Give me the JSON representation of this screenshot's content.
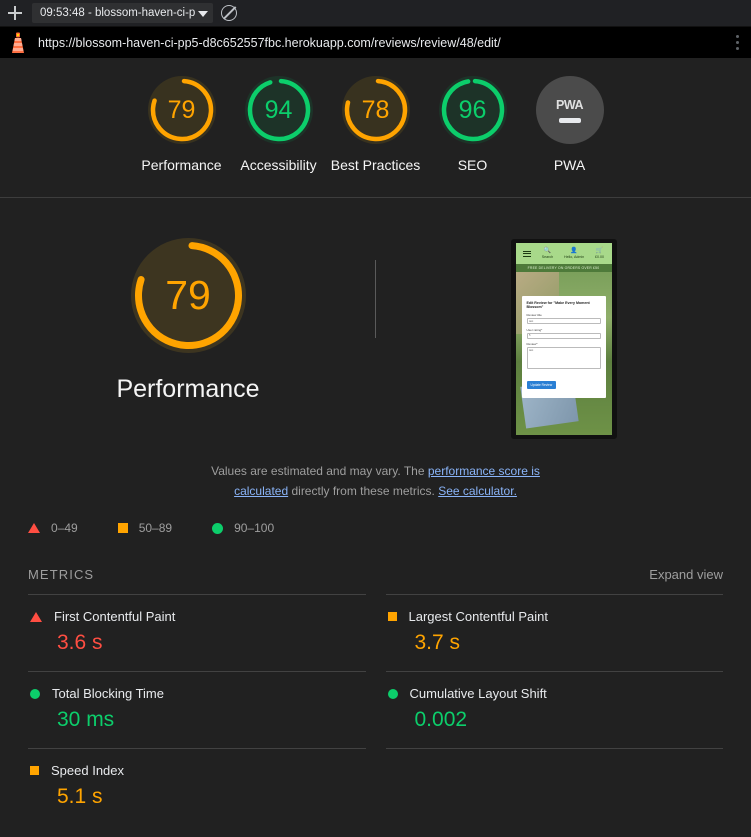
{
  "browser": {
    "new_tab_label": "+",
    "tab_selector_label": "09:53:48 - blossom-haven-ci-p",
    "block_icon": "no-entry-icon",
    "lighthouse_icon": "lighthouse-icon",
    "url": "https://blossom-haven-ci-pp5-d8c652557fbc.herokuapp.com/reviews/review/48/edit/",
    "menu_icon": "kebab-menu-icon"
  },
  "colors": {
    "orange": "#ffa400",
    "green": "#0cce6b",
    "red": "#ff4e42",
    "gray": "#757575",
    "link": "#8ab4f8",
    "background": "#212121"
  },
  "gauges": [
    {
      "score": "79",
      "label": "Performance",
      "status": "average"
    },
    {
      "score": "94",
      "label": "Accessibility",
      "status": "pass"
    },
    {
      "score": "78",
      "label": "Best Practices",
      "status": "average"
    },
    {
      "score": "96",
      "label": "SEO",
      "status": "pass"
    },
    {
      "score": "",
      "label": "PWA",
      "status": "null"
    }
  ],
  "category": {
    "score": "79",
    "title": "Performance",
    "description_part1": "Values are estimated and may vary. The ",
    "link1": "performance score is calculated",
    "description_part2": " directly from these metrics. ",
    "link2": "See calculator."
  },
  "legend": [
    {
      "marker": "triangle",
      "range": "0–49"
    },
    {
      "marker": "square",
      "range": "50–89"
    },
    {
      "marker": "circle",
      "range": "90–100"
    }
  ],
  "metrics": {
    "section_title": "METRICS",
    "expand_view": "Expand view",
    "items": [
      {
        "name": "First Contentful Paint",
        "value": "3.6 s",
        "status": "fail"
      },
      {
        "name": "Largest Contentful Paint",
        "value": "3.7 s",
        "status": "average"
      },
      {
        "name": "Total Blocking Time",
        "value": "30 ms",
        "status": "pass"
      },
      {
        "name": "Cumulative Layout Shift",
        "value": "0.002",
        "status": "pass"
      },
      {
        "name": "Speed Index",
        "value": "5.1 s",
        "status": "average"
      }
    ]
  },
  "thumbnail": {
    "nav_search": "Search",
    "nav_account": "Hello, Admin",
    "nav_cart": "£0.00",
    "banner": "FREE DELIVERY ON ORDERS OVER £50",
    "card_title": "Edit Review for \"Make Every Moment Blossom\"",
    "field1_label": "Review title",
    "field1_value": "test",
    "field2_label": "User rating*",
    "field2_value": "5",
    "field3_label": "Review*",
    "field3_value": "test",
    "button": "Update Review"
  }
}
